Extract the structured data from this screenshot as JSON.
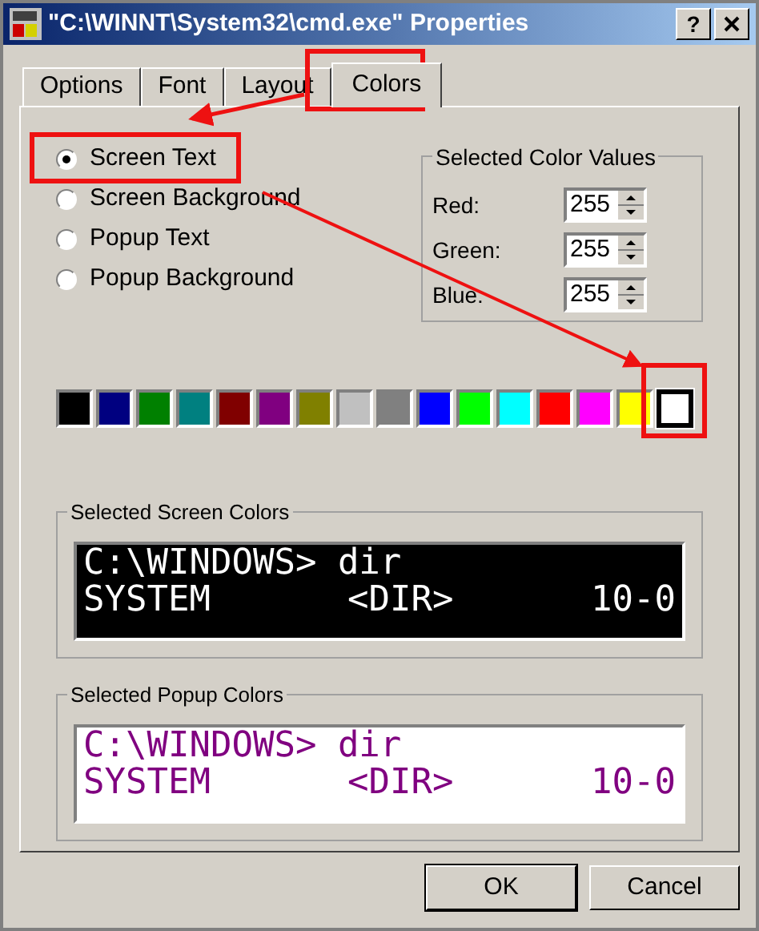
{
  "window": {
    "title": "\"C:\\WINNT\\System32\\cmd.exe\" Properties",
    "help": "?"
  },
  "tabs": [
    {
      "label": "Options",
      "selected": false
    },
    {
      "label": "Font",
      "selected": false
    },
    {
      "label": "Layout",
      "selected": false
    },
    {
      "label": "Colors",
      "selected": true
    }
  ],
  "radios": [
    {
      "label": "Screen Text",
      "selected": true
    },
    {
      "label": "Screen Background",
      "selected": false
    },
    {
      "label": "Popup Text",
      "selected": false
    },
    {
      "label": "Popup Background",
      "selected": false
    }
  ],
  "color_values": {
    "title": "Selected Color Values",
    "fields": [
      {
        "label": "Red:",
        "value": "255"
      },
      {
        "label": "Green:",
        "value": "255"
      },
      {
        "label": "Blue:",
        "value": "255"
      }
    ]
  },
  "palette": [
    {
      "color": "#000000",
      "selected": false
    },
    {
      "color": "#000080",
      "selected": false
    },
    {
      "color": "#008000",
      "selected": false
    },
    {
      "color": "#008080",
      "selected": false
    },
    {
      "color": "#800000",
      "selected": false
    },
    {
      "color": "#800080",
      "selected": false
    },
    {
      "color": "#808000",
      "selected": false
    },
    {
      "color": "#c0c0c0",
      "selected": false
    },
    {
      "color": "#808080",
      "selected": false
    },
    {
      "color": "#0000ff",
      "selected": false
    },
    {
      "color": "#00ff00",
      "selected": false
    },
    {
      "color": "#00ffff",
      "selected": false
    },
    {
      "color": "#ff0000",
      "selected": false
    },
    {
      "color": "#ff00ff",
      "selected": false
    },
    {
      "color": "#ffff00",
      "selected": false
    },
    {
      "color": "#ffffff",
      "selected": true
    }
  ],
  "previews": [
    {
      "kind": "screen",
      "title": "Selected Screen Colors",
      "lines": [
        [
          "C:\\WINDOWS> dir"
        ],
        [
          "SYSTEM",
          "<DIR>",
          "10-0"
        ]
      ]
    },
    {
      "kind": "popup",
      "title": "Selected Popup Colors",
      "lines": [
        [
          "C:\\WINDOWS> dir"
        ],
        [
          "SYSTEM",
          "<DIR>",
          "10-0"
        ]
      ]
    }
  ],
  "buttons": [
    "OK",
    "Cancel"
  ]
}
